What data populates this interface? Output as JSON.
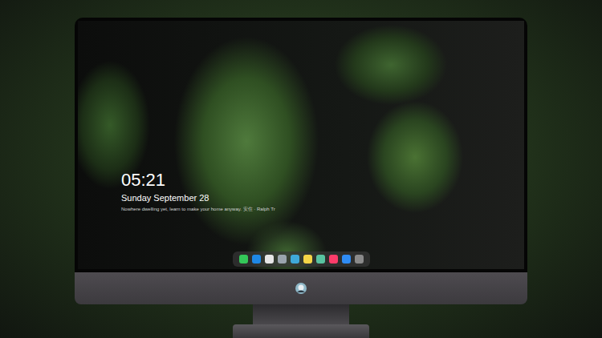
{
  "lock_screen": {
    "time": "05:21",
    "date": "Sunday September 28",
    "quote": "Nowhere dwelling yet, learn to make your home anyway. 安住 · Ralph Tr"
  },
  "dock": [
    {
      "color": "#34c759"
    },
    {
      "color": "#1e88e5"
    },
    {
      "color": "#e6e6e6"
    },
    {
      "color": "#9aa4ad"
    },
    {
      "color": "#3fa9d8"
    },
    {
      "color": "#f5d547"
    },
    {
      "color": "#58c2a0"
    },
    {
      "color": "#fc3c6a"
    },
    {
      "color": "#2f8cf5"
    },
    {
      "color": "#8a8a8a"
    }
  ]
}
